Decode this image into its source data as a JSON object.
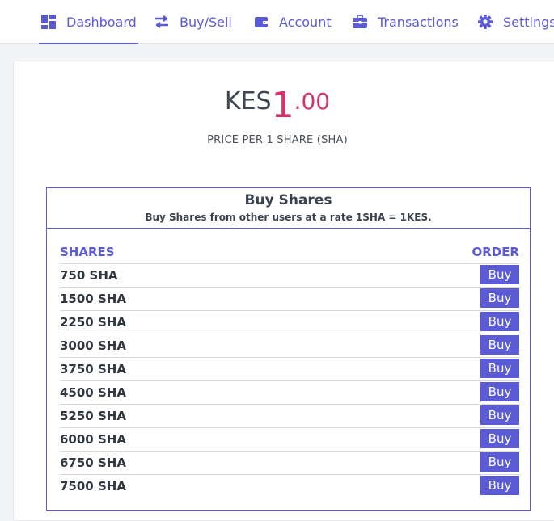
{
  "nav": {
    "items": [
      {
        "label": "Dashboard",
        "icon": "dashboard-icon"
      },
      {
        "label": "Buy/Sell",
        "icon": "exchange-arrows-icon"
      },
      {
        "label": "Account",
        "icon": "wallet-icon"
      },
      {
        "label": "Transactions",
        "icon": "briefcase-icon"
      },
      {
        "label": "Settings",
        "icon": "gear-icon"
      }
    ],
    "active": "Dashboard"
  },
  "price": {
    "currency": "KES",
    "integer": "1",
    "decimal": ".00",
    "caption": "PRICE PER 1 SHARE (SHA)"
  },
  "buy_shares": {
    "title": "Buy Shares",
    "subtitle": "Buy Shares from other users at a rate 1SHA = 1KES.",
    "col_shares": "SHARES",
    "col_order": "ORDER",
    "button_label": "Buy",
    "rows": [
      "750 SHA",
      "1500 SHA",
      "2250 SHA",
      "3000 SHA",
      "3750 SHA",
      "4500 SHA",
      "5250 SHA",
      "6000 SHA",
      "6750 SHA",
      "7500 SHA"
    ]
  },
  "colors": {
    "accent": "#5b5bd6",
    "price": "#d6336c",
    "text": "#3a4250"
  }
}
